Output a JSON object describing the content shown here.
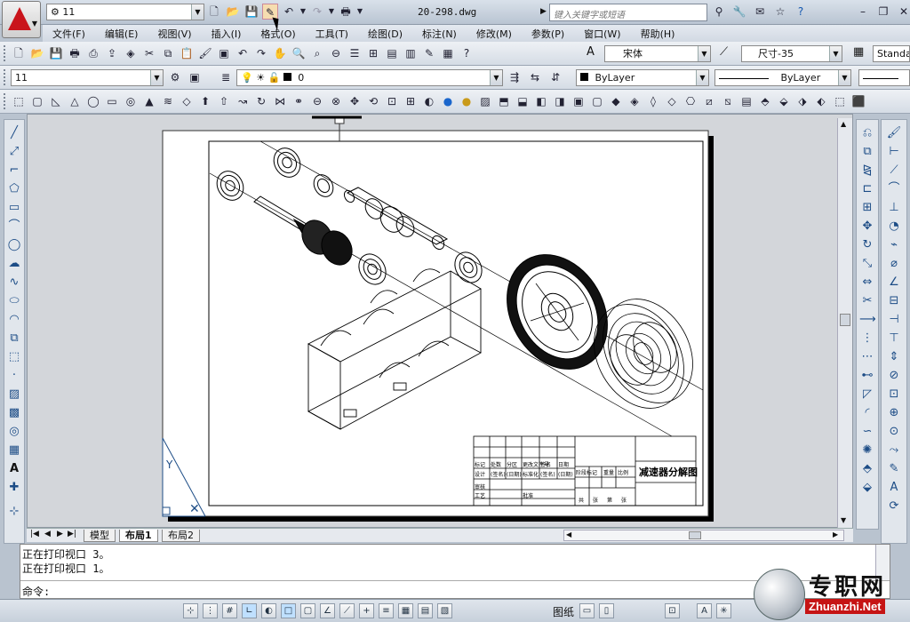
{
  "titlebar": {
    "workspace": "11",
    "document": "20-298.dwg",
    "search_placeholder": "键入关键字或短语"
  },
  "menu": [
    "文件(F)",
    "编辑(E)",
    "视图(V)",
    "插入(I)",
    "格式(O)",
    "工具(T)",
    "绘图(D)",
    "标注(N)",
    "修改(M)",
    "参数(P)",
    "窗口(W)",
    "帮助(H)"
  ],
  "toolbar1": {
    "text_style": "宋体",
    "dim_style": "尺寸-35",
    "table_style": "Standa"
  },
  "toolbar2": {
    "workspace": "11",
    "layer": "0",
    "color": "ByLayer",
    "linetype": "ByLayer"
  },
  "tabs": {
    "model": "模型",
    "layout1": "布局1",
    "layout2": "布局2"
  },
  "command": {
    "line1": "正在打印视口 3。",
    "line2": "正在打印视口 1。",
    "prompt": "命令:"
  },
  "status": {
    "paper": "图纸"
  },
  "drawing": {
    "title": "减速器分解图",
    "tb_r1": [
      "标记",
      "处数",
      "分区",
      "更改文件号",
      "签名",
      "日期"
    ],
    "tb_r2": [
      "设计",
      "(签名)",
      "(日期)",
      "标准化",
      "(签名)",
      "(日期)"
    ],
    "stage": "阶段标记",
    "weight": "重量",
    "scale": "比例",
    "review": "审核",
    "process": "工艺",
    "approve": "批准",
    "total": "共",
    "sheet_of": "张",
    "sheet_no": "第",
    "sheet": "张"
  },
  "watermark": {
    "brand": "专职网",
    "url": "Zhuanzhi.Net"
  }
}
